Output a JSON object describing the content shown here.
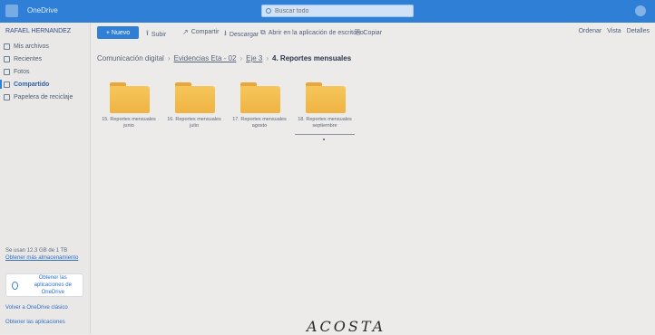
{
  "app": {
    "name": "OneDrive"
  },
  "search": {
    "value": "",
    "placeholder": "Buscar todo"
  },
  "sidebar": {
    "owner": "RAFAEL HERNANDEZ",
    "items": [
      {
        "label": "Mis archivos"
      },
      {
        "label": "Recientes"
      },
      {
        "label": "Fotos"
      },
      {
        "label": "Compartido"
      },
      {
        "label": "Papelera de reciclaje"
      }
    ],
    "storage_text": "Se usan 12.3 GB de 1 TB",
    "storage_link": "Obtener más almacenamiento",
    "apps_card": "Obtener las aplicaciones de OneDrive",
    "footer_link_1": "Volver a OneDrive clásico",
    "footer_link_2": "Obtener las aplicaciones"
  },
  "toolbar": {
    "new_label": "+ Nuevo",
    "items": [
      {
        "label": "Subir",
        "icon": "upload-icon"
      },
      {
        "label": "Compartir",
        "icon": "share-icon"
      },
      {
        "label": "Descargar",
        "icon": "download-icon"
      },
      {
        "label": "Abrir en la aplicación de escritorio",
        "icon": "open-icon"
      },
      {
        "label": "Copiar",
        "icon": "copy-icon"
      }
    ],
    "right": [
      "Ordenar",
      "Vista",
      "Detalles"
    ]
  },
  "breadcrumb": {
    "items": [
      "Comunicación digital",
      "Evidencias Eta - 02",
      "Eje 3",
      "4. Reportes mensuales"
    ]
  },
  "folders": [
    {
      "name": "15. Reportes mensuales junio"
    },
    {
      "name": "16. Reportes mensuales julio"
    },
    {
      "name": "17. Reportes mensuales agosto"
    },
    {
      "name": "18. Reportes mensuales septiembre"
    }
  ],
  "annotation": "ACOSTA"
}
